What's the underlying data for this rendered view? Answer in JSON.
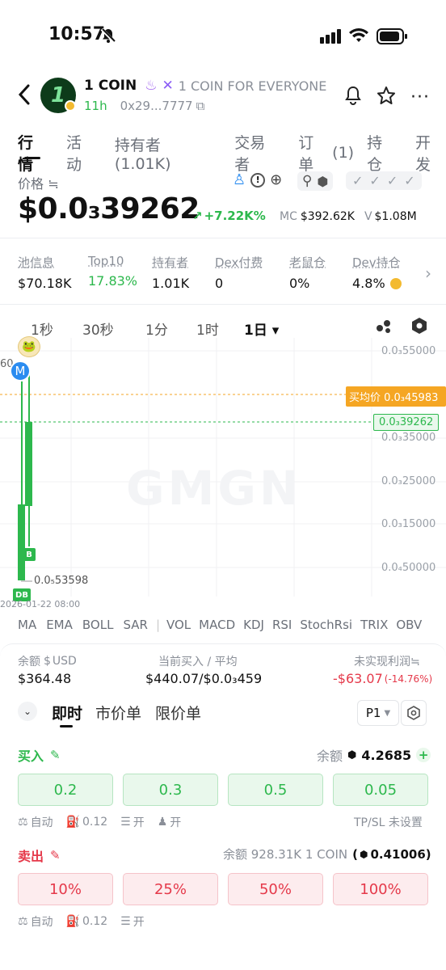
{
  "status": {
    "time": "10:57"
  },
  "token": {
    "name": "1 COIN",
    "slogan": "1 COIN FOR EVERYONE",
    "age": "11h",
    "address": "0x29...7777",
    "logo_text": "1"
  },
  "tabs": [
    {
      "label": "行情"
    },
    {
      "label": "活动"
    },
    {
      "label": "持有者(1.01K)"
    },
    {
      "label": "交易者"
    },
    {
      "label": "订单"
    },
    {
      "label": "(1)"
    },
    {
      "label": "持仓"
    },
    {
      "label": "开发"
    }
  ],
  "price": {
    "label": "价格 ≒",
    "value": "$0.0₃39262",
    "change": "+7.22K%",
    "mc_label": "MC",
    "mc_value": "$392.62K",
    "v_label": "V",
    "v_value": "$1.08M"
  },
  "stats": [
    {
      "label": "池信息",
      "value": "$70.18K"
    },
    {
      "label": "Top10",
      "value": "17.83%"
    },
    {
      "label": "持有者",
      "value": "1.01K"
    },
    {
      "label": "Dex付费",
      "value": "0"
    },
    {
      "label": "老鼠仓",
      "value": "0%"
    },
    {
      "label": "Dev持仓",
      "value": "4.8%"
    }
  ],
  "timeframes": [
    "1秒",
    "30秒",
    "1分",
    "1时",
    "1日 ▾"
  ],
  "chart": {
    "y_ticks": [
      "0.0₃55000",
      "0.0₃35000",
      "0.0₃25000",
      "0.0₃15000",
      "0.0₄50000"
    ],
    "avg_price_label": "买均价 0.0₃45983",
    "current_price_label": "0.0₃39262",
    "low_label": "0.0₅53598",
    "date_label": "2026-01-22 08:00",
    "left_cut": "60",
    "watermark": "GMGN",
    "marker_m": "M",
    "marker_b": "B",
    "marker_db": "DB"
  },
  "indicators": [
    "MA",
    "EMA",
    "BOLL",
    "SAR",
    "|",
    "VOL",
    "MACD",
    "KDJ",
    "RSI",
    "StochRsi",
    "TRIX",
    "OBV"
  ],
  "position": {
    "balance_label": "余额",
    "balance_unit": "USD",
    "balance_value": "$364.48",
    "buy_avg_label": "当前买入 / 平均",
    "buy_avg_value": "$440.07/$0.0₃459",
    "pnl_label": "未实现利润≒",
    "pnl_value": "-$63.07",
    "pnl_pct": "(-14.76%)"
  },
  "order_tabs": [
    "即时",
    "市价单",
    "限价单"
  ],
  "preset": "P1",
  "buy": {
    "label": "买入",
    "balance_label": "余额",
    "balance_value": "4.2685",
    "amounts": [
      "0.2",
      "0.3",
      "0.5",
      "0.05"
    ],
    "opts": [
      "自动",
      "0.12",
      "开",
      "开"
    ],
    "tpsl": "TP/SL 未设置"
  },
  "sell": {
    "label": "卖出",
    "balance_text": "余额 928.31K 1 COIN",
    "balance_paren": "(",
    "balance_value": "0.41006",
    "balance_close": ")",
    "pcts": [
      "10%",
      "25%",
      "50%",
      "100%"
    ],
    "opts": [
      "自动",
      "0.12",
      "开"
    ]
  },
  "colors": {
    "green": "#2db84d",
    "red": "#e5394a",
    "orange": "#f5a623",
    "blue": "#2b8cf0"
  }
}
